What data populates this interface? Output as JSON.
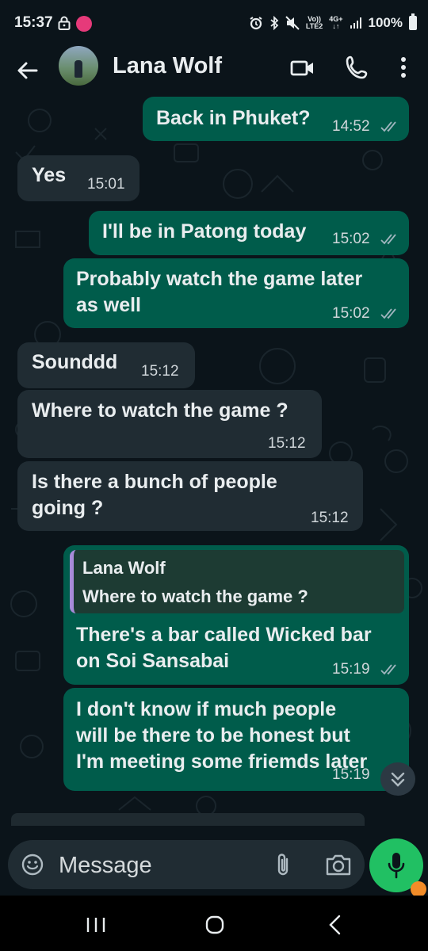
{
  "status_bar": {
    "time": "15:37",
    "app_badge": "",
    "network_top": "Vo))",
    "network_bottom": "LTE2",
    "network_gen": "4G+",
    "battery": "100%"
  },
  "header": {
    "contact_name": "Lana Wolf"
  },
  "messages": [
    {
      "direction": "out",
      "text": "Back in Phuket?",
      "time": "14:52",
      "ticks": "read"
    },
    {
      "direction": "in",
      "text": "Yes",
      "time": "15:01"
    },
    {
      "direction": "out",
      "text": "I'll be in Patong today",
      "time": "15:02",
      "ticks": "read"
    },
    {
      "direction": "out",
      "text": "Probably watch the game later\nas well",
      "time": "15:02",
      "ticks": "read"
    },
    {
      "direction": "in",
      "text": "Sounddd",
      "time": "15:12"
    },
    {
      "direction": "in",
      "text": "Where to watch the game ?",
      "time": "15:12"
    },
    {
      "direction": "in",
      "text": "Is there a bunch of people\ngoing ?",
      "time": "15:12"
    },
    {
      "direction": "out",
      "text": "There's a bar called Wicked bar\non Soi Sansabai",
      "time": "15:19",
      "ticks": "read",
      "quote": {
        "name": "Lana Wolf",
        "text": "Where to watch the game ?"
      }
    },
    {
      "direction": "out",
      "text": "I don't know if much people\nwill be there to be honest but\nI'm meeting some friemds later",
      "time": "15:19"
    }
  ],
  "input": {
    "placeholder": "Message"
  },
  "colors": {
    "background": "#0b141a",
    "outgoing_bubble": "#005c4b",
    "incoming_bubble": "#202c33",
    "accent_green": "#21c063",
    "quote_bar": "#a78bd9"
  },
  "icons": [
    "back-arrow-icon",
    "video-call-icon",
    "phone-icon",
    "more-vert-icon",
    "emoji-icon",
    "attach-icon",
    "camera-icon",
    "mic-icon",
    "double-check-icon",
    "scroll-down-icon"
  ]
}
